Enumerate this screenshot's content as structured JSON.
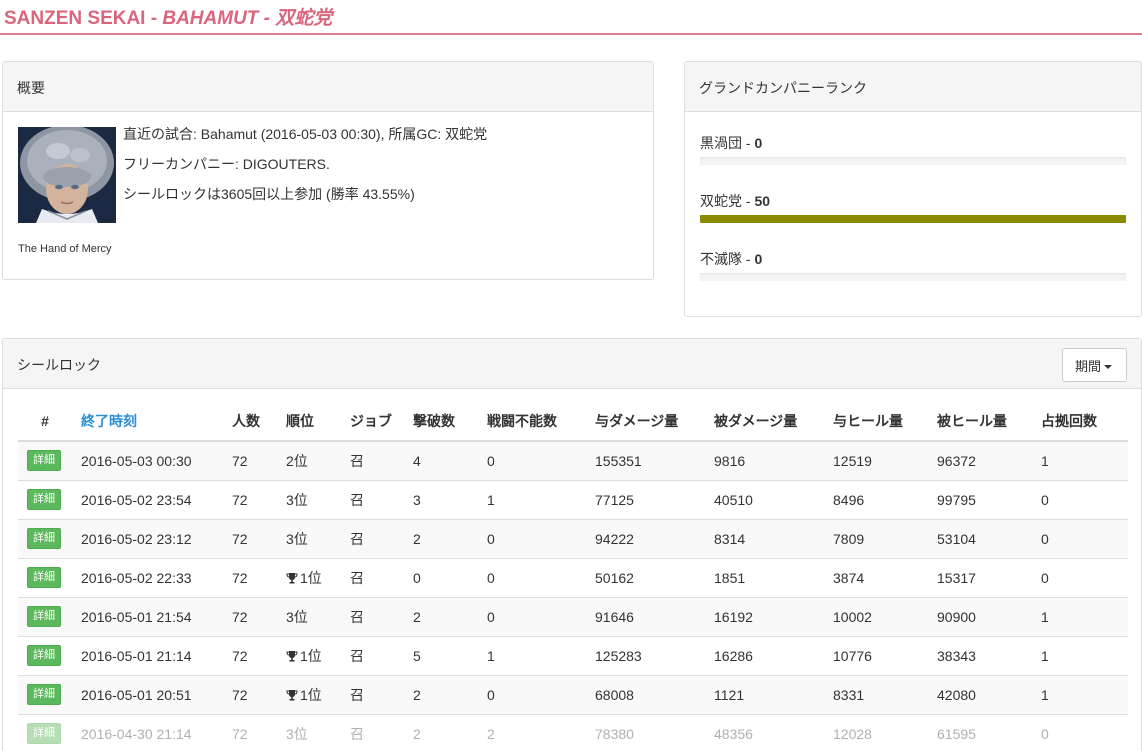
{
  "header": {
    "prefix": "SANZEN SEKAI - ",
    "server": "BAHAMUT",
    "sep": " - ",
    "gc": "双蛇党",
    "accent_color": "#d9667c"
  },
  "overview": {
    "title": "概要",
    "character_name": "The Hand of Mercy",
    "last_match": "直近の試合: Bahamut (2016-05-03 00:30), 所属GC: 双蛇党",
    "free_company": "フリーカンパニー: DIGOUTERS.",
    "participation": "シールロックは3605回以上参加 (勝率 43.55%)"
  },
  "gc_rank": {
    "title": "グランドカンパニーランク",
    "bar_color": "#8a8a00",
    "items": [
      {
        "name": "黒渦団",
        "sep": " - ",
        "rank": "0",
        "fill": 0
      },
      {
        "name": "双蛇党",
        "sep": " - ",
        "rank": "50",
        "fill": 1
      },
      {
        "name": "不滅隊",
        "sep": " - ",
        "rank": "0",
        "fill": 0
      }
    ]
  },
  "seal_rock": {
    "title": "シールロック",
    "period_label": "期間",
    "columns": [
      "#",
      "終了時刻",
      "人数",
      "順位",
      "ジョブ",
      "撃破数",
      "戦闘不能数",
      "与ダメージ量",
      "被ダメージ量",
      "与ヒール量",
      "被ヒール量",
      "占拠回数"
    ],
    "detail_label": "詳細",
    "rows": [
      {
        "time": "2016-05-03 00:30",
        "players": "72",
        "rank": "2位",
        "trophy": false,
        "job": "召",
        "kills": "4",
        "deaths": "0",
        "dmg_dealt": "155351",
        "dmg_taken": "9816",
        "heal_dealt": "12519",
        "heal_taken": "96372",
        "captures": "1"
      },
      {
        "time": "2016-05-02 23:54",
        "players": "72",
        "rank": "3位",
        "trophy": false,
        "job": "召",
        "kills": "3",
        "deaths": "1",
        "dmg_dealt": "77125",
        "dmg_taken": "40510",
        "heal_dealt": "8496",
        "heal_taken": "99795",
        "captures": "0"
      },
      {
        "time": "2016-05-02 23:12",
        "players": "72",
        "rank": "3位",
        "trophy": false,
        "job": "召",
        "kills": "2",
        "deaths": "0",
        "dmg_dealt": "94222",
        "dmg_taken": "8314",
        "heal_dealt": "7809",
        "heal_taken": "53104",
        "captures": "0"
      },
      {
        "time": "2016-05-02 22:33",
        "players": "72",
        "rank": "1位",
        "trophy": true,
        "job": "召",
        "kills": "0",
        "deaths": "0",
        "dmg_dealt": "50162",
        "dmg_taken": "1851",
        "heal_dealt": "3874",
        "heal_taken": "15317",
        "captures": "0"
      },
      {
        "time": "2016-05-01 21:54",
        "players": "72",
        "rank": "3位",
        "trophy": false,
        "job": "召",
        "kills": "2",
        "deaths": "0",
        "dmg_dealt": "91646",
        "dmg_taken": "16192",
        "heal_dealt": "10002",
        "heal_taken": "90900",
        "captures": "1"
      },
      {
        "time": "2016-05-01 21:14",
        "players": "72",
        "rank": "1位",
        "trophy": true,
        "job": "召",
        "kills": "5",
        "deaths": "1",
        "dmg_dealt": "125283",
        "dmg_taken": "16286",
        "heal_dealt": "10776",
        "heal_taken": "38343",
        "captures": "1"
      },
      {
        "time": "2016-05-01 20:51",
        "players": "72",
        "rank": "1位",
        "trophy": true,
        "job": "召",
        "kills": "2",
        "deaths": "0",
        "dmg_dealt": "68008",
        "dmg_taken": "1121",
        "heal_dealt": "8331",
        "heal_taken": "42080",
        "captures": "1"
      },
      {
        "time": "2016-04-30 21:14",
        "players": "72",
        "rank": "3位",
        "trophy": false,
        "job": "召",
        "kills": "2",
        "deaths": "2",
        "dmg_dealt": "78380",
        "dmg_taken": "48356",
        "heal_dealt": "12028",
        "heal_taken": "61595",
        "captures": "0"
      }
    ]
  }
}
